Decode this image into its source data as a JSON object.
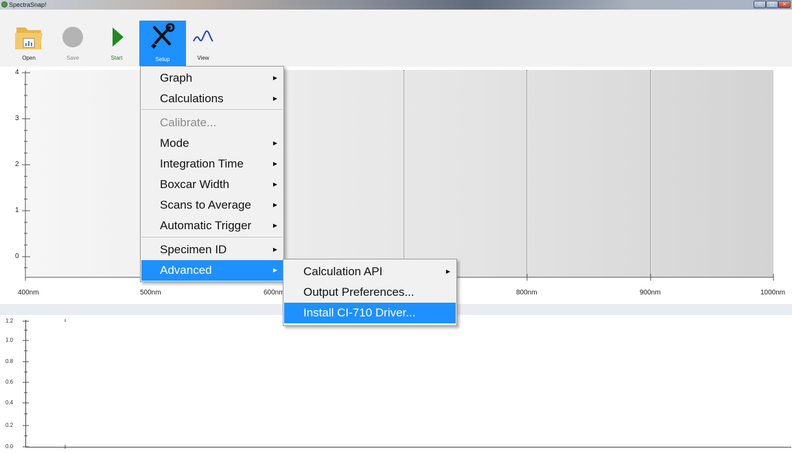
{
  "window": {
    "title": "SpectraSnap!"
  },
  "toolbar": {
    "open_label": "Open",
    "save_label": "Save",
    "start_label": "Start",
    "setup_label": "Setup",
    "view_label": "View"
  },
  "graph_top": {
    "y_ticks": [
      "4",
      "3",
      "2",
      "1",
      "0"
    ],
    "x_ticks": [
      "400nm",
      "500nm",
      "600nm",
      "800nm",
      "900nm",
      "1000nm"
    ]
  },
  "graph_bottom": {
    "y_ticks": [
      "1.2",
      "1.0",
      "0.8",
      "0.6",
      "0.4",
      "0.2",
      "0.0"
    ]
  },
  "setup_menu": {
    "items": [
      {
        "label": "Graph"
      },
      {
        "label": "Calculations"
      },
      {
        "label": "Calibrate..."
      },
      {
        "label": "Mode"
      },
      {
        "label": "Integration Time"
      },
      {
        "label": "Boxcar Width"
      },
      {
        "label": "Scans to Average"
      },
      {
        "label": "Automatic Trigger"
      },
      {
        "label": "Specimen ID"
      },
      {
        "label": "Advanced"
      }
    ]
  },
  "advanced_menu": {
    "items": [
      {
        "label": "Calculation API"
      },
      {
        "label": "Output Preferences..."
      },
      {
        "label": "Install CI-710 Driver..."
      }
    ]
  },
  "colors": {
    "accent": "#1e90ff",
    "start_green": "#1b7a1b"
  }
}
